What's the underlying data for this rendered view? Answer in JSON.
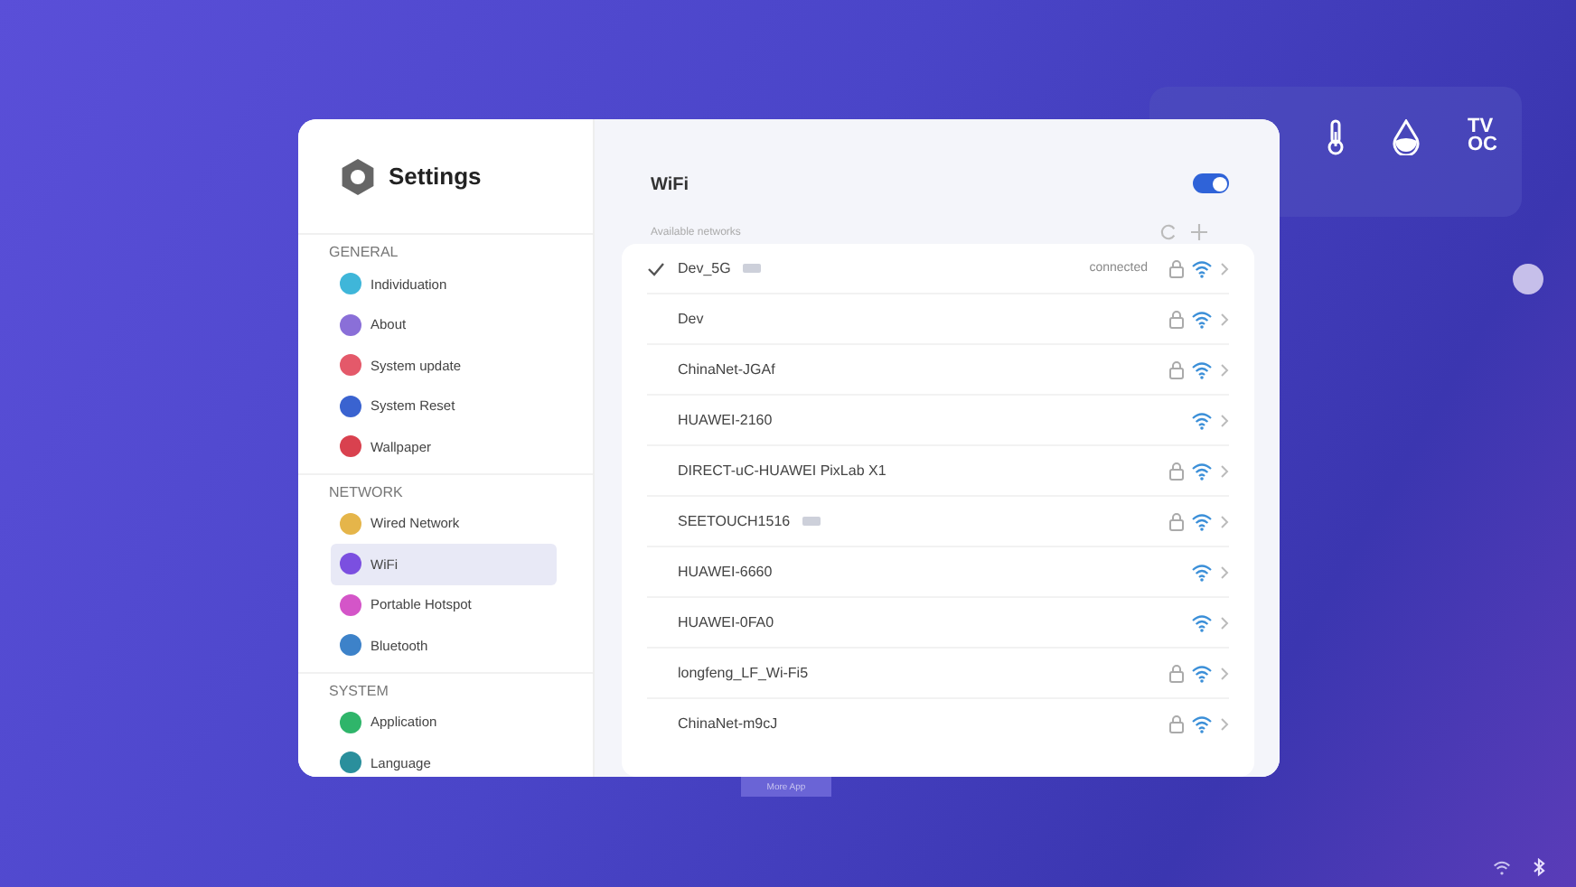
{
  "settings": {
    "title": "Settings",
    "sections": [
      {
        "heading": "GENERAL",
        "items": [
          {
            "label": "Individuation",
            "selected": false,
            "color": "#3fb6d9"
          },
          {
            "label": "About",
            "selected": false,
            "color": "#8a6fd8"
          },
          {
            "label": "System update",
            "selected": false,
            "color": "#e4596a"
          },
          {
            "label": "System Reset",
            "selected": false,
            "color": "#3a63d0"
          },
          {
            "label": "Wallpaper",
            "selected": false,
            "color": "#d9414f"
          }
        ]
      },
      {
        "heading": "NETWORK",
        "items": [
          {
            "label": "Wired Network",
            "selected": false,
            "color": "#e5b54a"
          },
          {
            "label": "WiFi",
            "selected": true,
            "color": "#7b4fe0"
          },
          {
            "label": "Portable Hotspot",
            "selected": false,
            "color": "#d455c8"
          },
          {
            "label": "Bluetooth",
            "selected": false,
            "color": "#3d82c9"
          }
        ]
      },
      {
        "heading": "SYSTEM",
        "items": [
          {
            "label": "Application",
            "selected": false,
            "color": "#2fb56a"
          },
          {
            "label": "Language",
            "selected": false,
            "color": "#2a8f9c"
          }
        ]
      }
    ]
  },
  "wifi": {
    "title": "WiFi",
    "on": true,
    "available_label": "Available networks",
    "networks": [
      {
        "name": "Dev_5G",
        "connected": true,
        "status": "connected",
        "tag": true,
        "secured": true
      },
      {
        "name": "Dev",
        "connected": false,
        "tag": false,
        "secured": true
      },
      {
        "name": "ChinaNet-JGAf",
        "connected": false,
        "tag": false,
        "secured": true
      },
      {
        "name": "HUAWEI-2160",
        "connected": false,
        "tag": false,
        "secured": false
      },
      {
        "name": "DIRECT-uC-HUAWEI PixLab X1",
        "connected": false,
        "tag": false,
        "secured": true
      },
      {
        "name": "SEETOUCH1516",
        "connected": false,
        "tag": true,
        "secured": true
      },
      {
        "name": "HUAWEI-6660",
        "connected": false,
        "tag": false,
        "secured": false
      },
      {
        "name": "HUAWEI-0FA0",
        "connected": false,
        "tag": false,
        "secured": false
      },
      {
        "name": "longfeng_LF_Wi-Fi5",
        "connected": false,
        "tag": false,
        "secured": true
      },
      {
        "name": "ChinaNet-m9cJ",
        "connected": false,
        "tag": false,
        "secured": true
      }
    ]
  },
  "widget": {
    "tvoc_label": "TVOC"
  },
  "dock": {
    "more_app": "More App"
  }
}
